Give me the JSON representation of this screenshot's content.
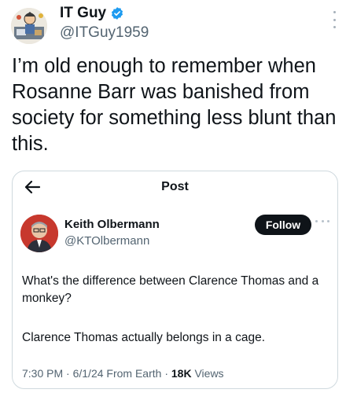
{
  "author": {
    "display_name": "IT Guy",
    "handle": "@ITGuy1959",
    "verified_icon": "verified-badge-icon",
    "avatar_icon": "cartoon-avatar"
  },
  "tweet": {
    "text": "I’m old enough to remember when Rosanne Barr was banished from society for something less blunt than this."
  },
  "quoted_post": {
    "header_title": "Post",
    "back_icon": "back-arrow-icon",
    "author_name": "Keith Olbermann",
    "author_handle": "@KTOlbermann",
    "follow_label": "Follow",
    "text_p1": "What's the difference between Clarence Thomas and a monkey?",
    "text_p2": "Clarence Thomas actually belongs in a cage.",
    "time": "7:30 PM",
    "date": "6/1/24",
    "source": "From Earth",
    "views_count": "18K",
    "views_label": "Views"
  },
  "colors": {
    "verified": "#1d9bf0",
    "text_primary": "#0f1419",
    "text_secondary": "#536471",
    "follow_button": "#0f1419",
    "card_border": "#cfd9de"
  }
}
